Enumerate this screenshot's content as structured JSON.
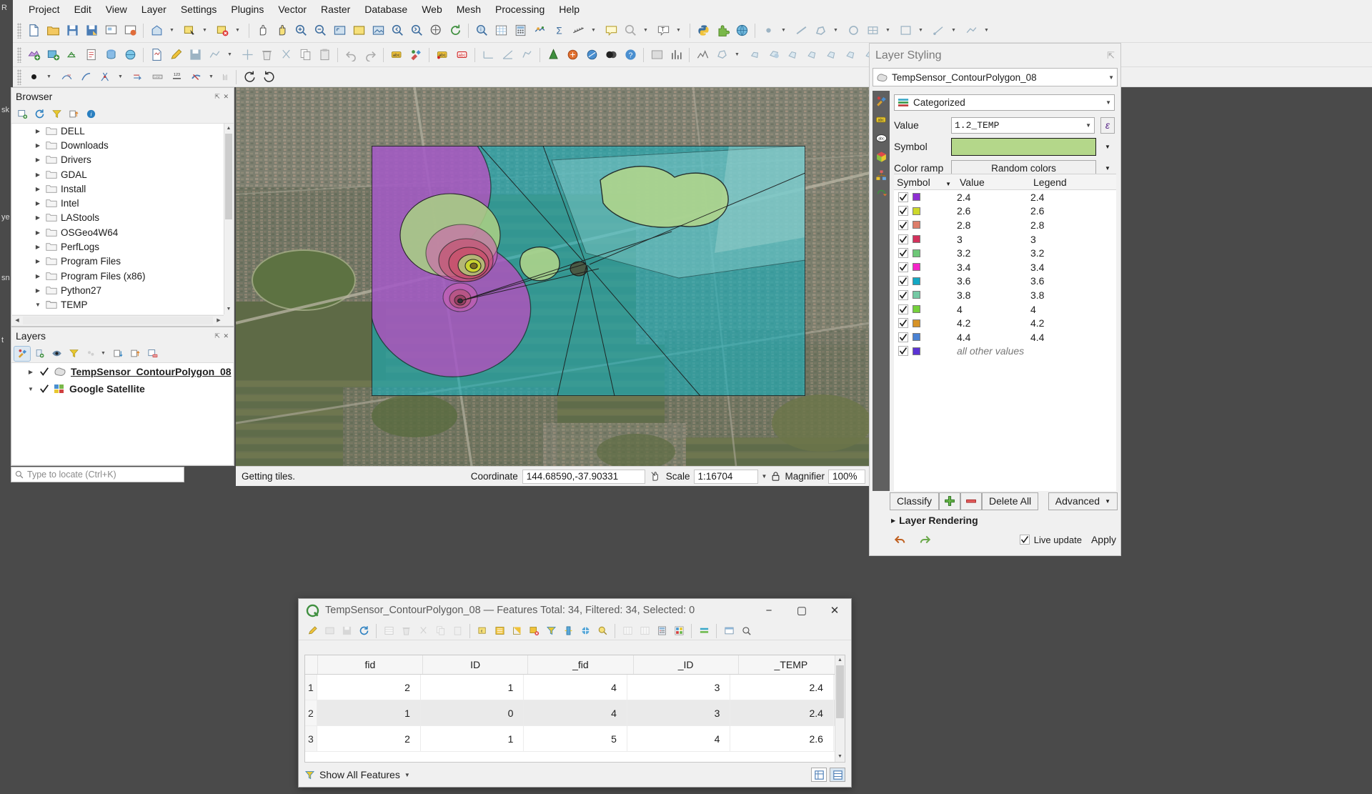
{
  "menu": {
    "items": [
      "Project",
      "Edit",
      "View",
      "Layer",
      "Settings",
      "Plugins",
      "Vector",
      "Raster",
      "Database",
      "Web",
      "Mesh",
      "Processing",
      "Help"
    ]
  },
  "left_strip": {
    "fragments": [
      "R",
      "sk",
      "ye",
      "sn",
      "t"
    ]
  },
  "browser": {
    "title": "Browser",
    "tools": [
      "add-layer-icon",
      "refresh-icon",
      "filter-icon",
      "collapse-all-icon",
      "info-icon"
    ],
    "items": [
      {
        "label": "DELL",
        "expanded": false
      },
      {
        "label": "Downloads",
        "expanded": false
      },
      {
        "label": "Drivers",
        "expanded": false
      },
      {
        "label": "GDAL",
        "expanded": false
      },
      {
        "label": "Install",
        "expanded": false
      },
      {
        "label": "Intel",
        "expanded": false
      },
      {
        "label": "LAStools",
        "expanded": false
      },
      {
        "label": "OSGeo4W64",
        "expanded": false
      },
      {
        "label": "PerfLogs",
        "expanded": false
      },
      {
        "label": "Program Files",
        "expanded": false
      },
      {
        "label": "Program Files (x86)",
        "expanded": false
      },
      {
        "label": "Python27",
        "expanded": false
      },
      {
        "label": "TEMP",
        "expanded": true
      }
    ]
  },
  "layers": {
    "title": "Layers",
    "tools": [
      "styling-dock-icon",
      "add-group-icon",
      "manage-visibility-icon",
      "filter-legend-icon",
      "expression-filter-icon",
      "expand-all-icon",
      "collapse-all-icon",
      "remove-layer-icon"
    ],
    "items": [
      {
        "label": "TempSensor_ContourPolygon_08",
        "checked": true,
        "selected": true,
        "icon": "polygon-layer-icon"
      },
      {
        "label": "Google Satellite",
        "checked": true,
        "selected": false,
        "icon": "raster-layer-icon"
      }
    ]
  },
  "locate": {
    "placeholder": "Type to locate (Ctrl+K)"
  },
  "status": {
    "message": "Getting tiles.",
    "coordinate_label": "Coordinate",
    "coordinate_value": "144.68590,-37.90331",
    "scale_label": "Scale",
    "scale_value": "1:16704",
    "magnifier_label": "Magnifier",
    "magnifier_value": "100%"
  },
  "styling": {
    "title": "Layer Styling",
    "layer_name": "TempSensor_ContourPolygon_08",
    "renderer": "Categorized",
    "value_label": "Value",
    "value_field": "1.2_TEMP",
    "symbol_label": "Symbol",
    "symbol_color": "#b4d78a",
    "colorramp_label": "Color ramp",
    "colorramp_value": "Random colors",
    "expression_button": "ε",
    "columns": {
      "symbol": "Symbol",
      "value": "Value",
      "legend": "Legend"
    },
    "categories": [
      {
        "color": "#8e2fd2",
        "value": "2.4",
        "legend": "2.4",
        "checked": true
      },
      {
        "color": "#cdd82a",
        "value": "2.6",
        "legend": "2.6",
        "checked": true
      },
      {
        "color": "#dd7d6a",
        "value": "2.8",
        "legend": "2.8",
        "checked": true
      },
      {
        "color": "#d3315c",
        "value": "3",
        "legend": "3",
        "checked": true
      },
      {
        "color": "#6ec878",
        "value": "3.2",
        "legend": "3.2",
        "checked": true
      },
      {
        "color": "#f425c8",
        "value": "3.4",
        "legend": "3.4",
        "checked": true
      },
      {
        "color": "#13a8c4",
        "value": "3.6",
        "legend": "3.6",
        "checked": true
      },
      {
        "color": "#74c9a4",
        "value": "3.8",
        "legend": "3.8",
        "checked": true
      },
      {
        "color": "#75d13b",
        "value": "4",
        "legend": "4",
        "checked": true
      },
      {
        "color": "#d79327",
        "value": "4.2",
        "legend": "4.2",
        "checked": true
      },
      {
        "color": "#4a82d3",
        "value": "4.4",
        "legend": "4.4",
        "checked": true
      },
      {
        "color": "#5b33d4",
        "value": "all other values",
        "legend": "",
        "checked": true,
        "is_other": true
      }
    ],
    "buttons": {
      "classify": "Classify",
      "add": "add-category-icon",
      "remove": "remove-category-icon",
      "delete_all": "Delete All",
      "advanced": "Advanced"
    },
    "layer_rendering": "Layer Rendering",
    "undo": "undo-icon",
    "redo": "redo-icon",
    "live_update": "Live update",
    "apply": "Apply"
  },
  "attribute_table": {
    "title": "TempSensor_ContourPolygon_08 — Features Total: 34, Filtered: 34, Selected: 0",
    "window_controls": [
      "minimize-icon",
      "maximize-icon",
      "close-icon"
    ],
    "columns": [
      "fid",
      "ID",
      "_fid",
      "_ID",
      "_TEMP"
    ],
    "rows": [
      {
        "n": "1",
        "cells": [
          "2",
          "1",
          "4",
          "3",
          "2.4"
        ]
      },
      {
        "n": "2",
        "cells": [
          "1",
          "0",
          "4",
          "3",
          "2.4"
        ]
      },
      {
        "n": "3",
        "cells": [
          "2",
          "1",
          "5",
          "4",
          "2.6"
        ]
      }
    ],
    "footer": {
      "filter_label": "Show All Features",
      "view_form": "form-view-icon",
      "view_table": "table-view-icon"
    }
  }
}
